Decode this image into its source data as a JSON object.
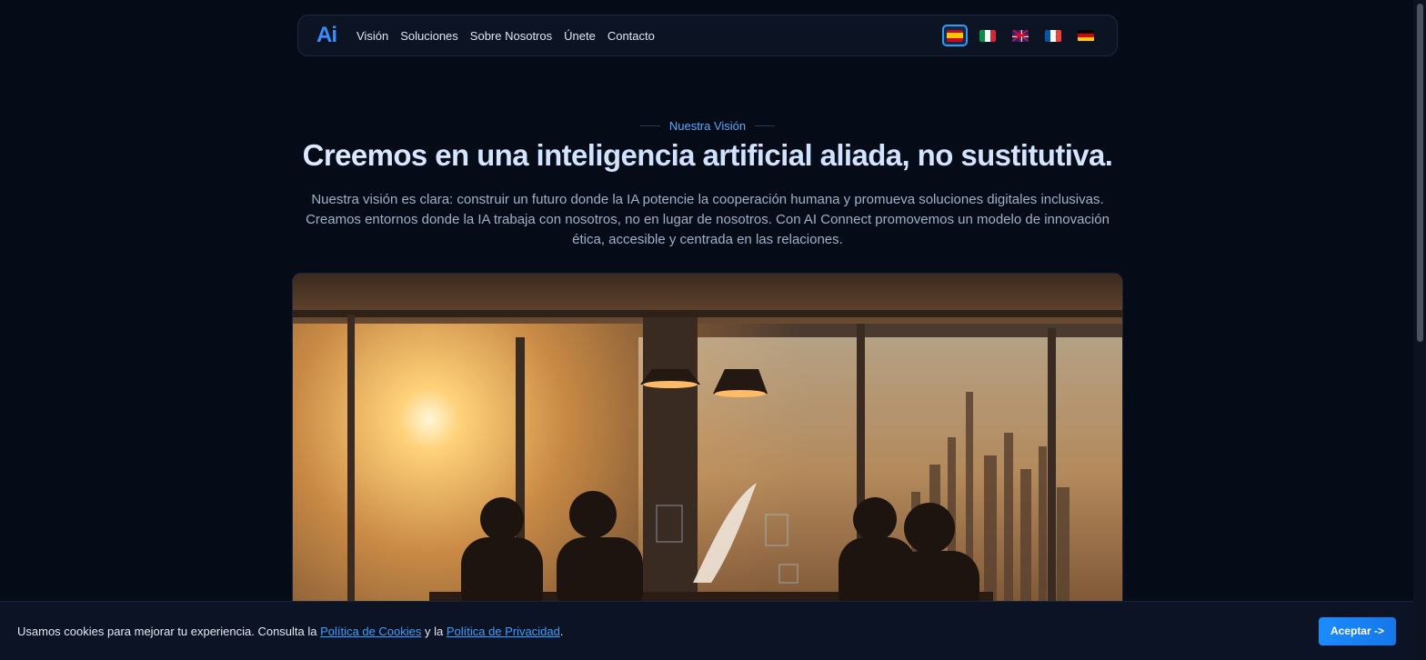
{
  "nav": {
    "logo_text": "Ai",
    "links": [
      "Visión",
      "Soluciones",
      "Sobre Nosotros",
      "Únete",
      "Contacto"
    ],
    "languages": [
      {
        "code": "es",
        "icon": "spain-flag-icon",
        "active": true
      },
      {
        "code": "it",
        "icon": "italy-flag-icon",
        "active": false
      },
      {
        "code": "en",
        "icon": "uk-flag-icon",
        "active": false
      },
      {
        "code": "fr",
        "icon": "france-flag-icon",
        "active": false
      },
      {
        "code": "de",
        "icon": "germany-flag-icon",
        "active": false
      }
    ]
  },
  "hero": {
    "eyebrow": "Nuestra Visión",
    "title": "Creemos en una inteligencia artificial aliada, no sustitutiva.",
    "text": "Nuestra visión es clara: construir un futuro donde la IA potencie la cooperación humana y promueva soluciones digitales inclusivas. Creamos entornos donde la IA trabaja con nosotros, no en lugar de nosotros. Con AI Connect promovemos un modelo de innovación ética, accesible y centrada en las relaciones."
  },
  "cookie": {
    "text_before": "Usamos cookies para mejorar tu experiencia. Consulta la ",
    "link_cookies": "Política de Cookies",
    "text_middle": " y la ",
    "link_privacy": "Política de Privacidad",
    "text_after": ".",
    "accept_label": "Aceptar ->"
  },
  "colors": {
    "background": "#050b17",
    "accent": "#1a8cff",
    "eyebrow": "#5aa9ff"
  }
}
